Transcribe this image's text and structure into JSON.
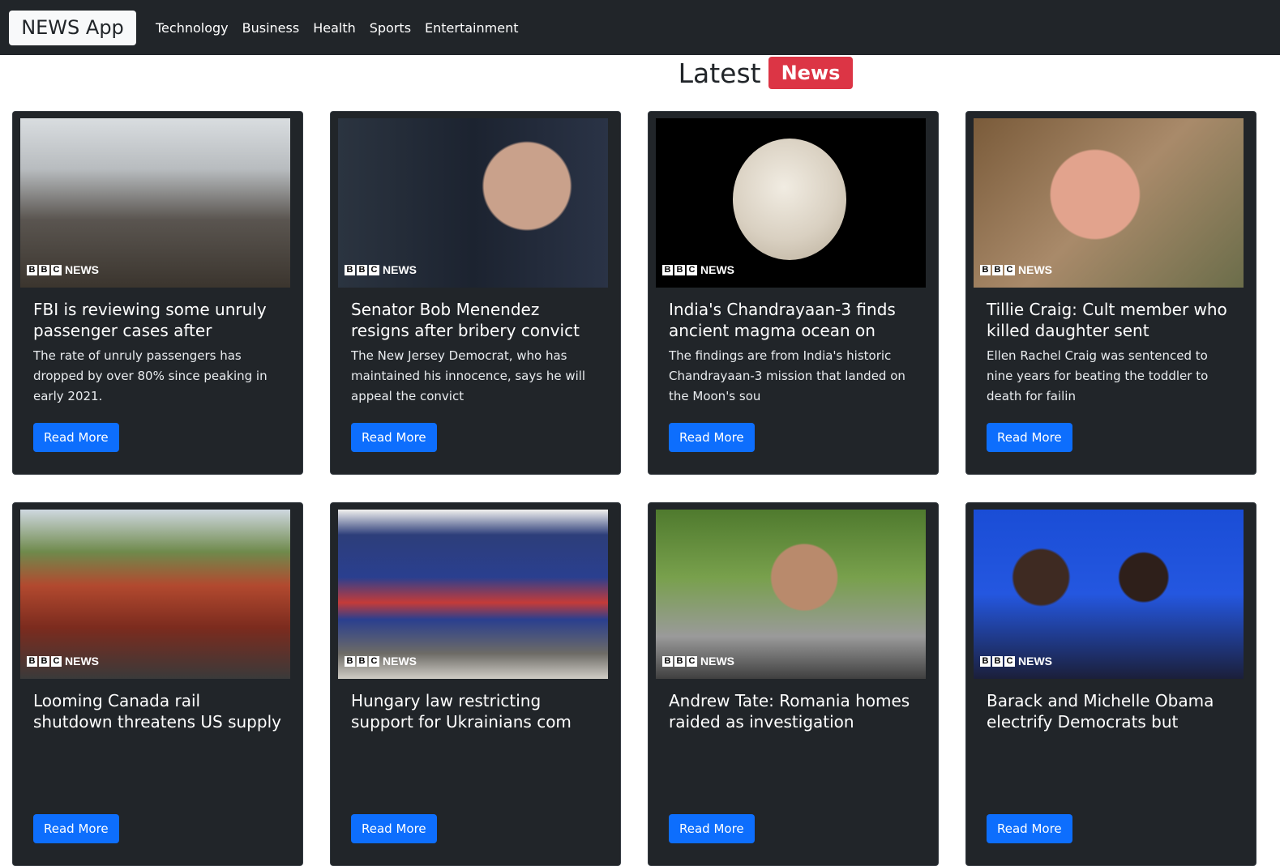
{
  "navbar": {
    "brand": "NEWS App",
    "links": [
      "Technology",
      "Business",
      "Health",
      "Sports",
      "Entertainment"
    ]
  },
  "heading": {
    "text": "Latest",
    "badge": "News"
  },
  "logo": {
    "letters": [
      "B",
      "B",
      "C"
    ],
    "word": "NEWS"
  },
  "cards": [
    {
      "title": "FBI is reviewing some unruly passenger cases after",
      "description": "The rate of unruly passengers has dropped by over 80% since peaking in early 2021.",
      "button": "Read More",
      "image": "airplane-cabin-photo"
    },
    {
      "title": "Senator Bob Menendez resigns after bribery convict",
      "description": "The New Jersey Democrat, who has maintained his innocence, says he will appeal the convict",
      "button": "Read More",
      "image": "senator-photo"
    },
    {
      "title": "India's Chandrayaan-3 finds ancient magma ocean on",
      "description": "The findings are from India's historic Chandrayaan-3 mission that landed on the Moon's sou",
      "button": "Read More",
      "image": "moon-photo"
    },
    {
      "title": "Tillie Craig: Cult member who killed daughter sent",
      "description": "Ellen Rachel Craig was sentenced to nine years for beating the toddler to death for failin",
      "button": "Read More",
      "image": "child-photo"
    },
    {
      "title": "Looming Canada rail shutdown threatens US supply c",
      "description": "",
      "button": "Read More",
      "image": "locomotive-photo"
    },
    {
      "title": "Hungary law restricting support for Ukrainians com",
      "description": "",
      "button": "Read More",
      "image": "train-station-photo"
    },
    {
      "title": "Andrew Tate: Romania homes raided as investigation",
      "description": "",
      "button": "Read More",
      "image": "man-with-sunglasses-photo"
    },
    {
      "title": "Barack and Michelle Obama electrify Democrats but",
      "description": "",
      "button": "Read More",
      "image": "obamas-on-stage-photo"
    }
  ],
  "colors": {
    "navbar_bg": "#212529",
    "card_bg": "#212529",
    "badge_bg": "#dc3545",
    "button_bg": "#0d6efd"
  }
}
